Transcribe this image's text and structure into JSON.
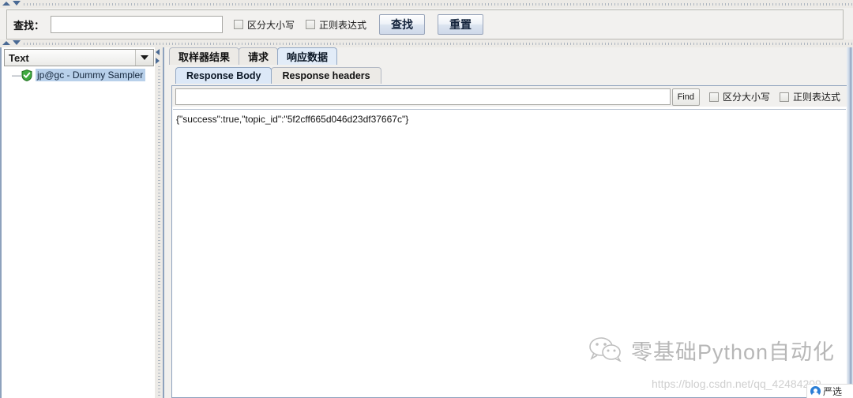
{
  "find_toolbar": {
    "label": "查找：",
    "input_value": "",
    "input_placeholder": "",
    "match_case_label": "区分大小写",
    "regex_label": "正则表达式",
    "find_button": "查找",
    "reset_button": "重置"
  },
  "left_panel": {
    "combo_value": "Text",
    "combo_options": [
      "Text"
    ],
    "tree_items": [
      {
        "label": "jp@gc - Dummy Sampler",
        "icon": "green-shield-icon",
        "selected": true
      }
    ]
  },
  "result_tabs": [
    {
      "label": "取样器结果",
      "selected": false
    },
    {
      "label": "请求",
      "selected": false
    },
    {
      "label": "响应数据",
      "selected": true
    }
  ],
  "response_tabs": [
    {
      "label": "Response Body",
      "selected": true
    },
    {
      "label": "Response headers",
      "selected": false
    }
  ],
  "response_find": {
    "input_value": "",
    "input_placeholder": "",
    "find_button": "Find",
    "match_case_label": "区分大小写",
    "regex_label": "正则表达式"
  },
  "response_body": {
    "text": "{\"success\":true,\"topic_id\":\"5f2cff665d046d23df37667c\"}"
  },
  "watermark": {
    "brand_text": "零基础Python自动化",
    "icon": "wechat-icon",
    "url": "https://blog.csdn.net/qq_42484209"
  },
  "corner_badge": {
    "label": "严选",
    "icon": "user-avatar-icon"
  },
  "colors": {
    "accent": "#8ea2bd",
    "tab_selected": "#dce8f7",
    "tree_selection": "#b8d0ea",
    "shield_green": "#3faa3f",
    "panel_bg": "#f1f0ee"
  }
}
